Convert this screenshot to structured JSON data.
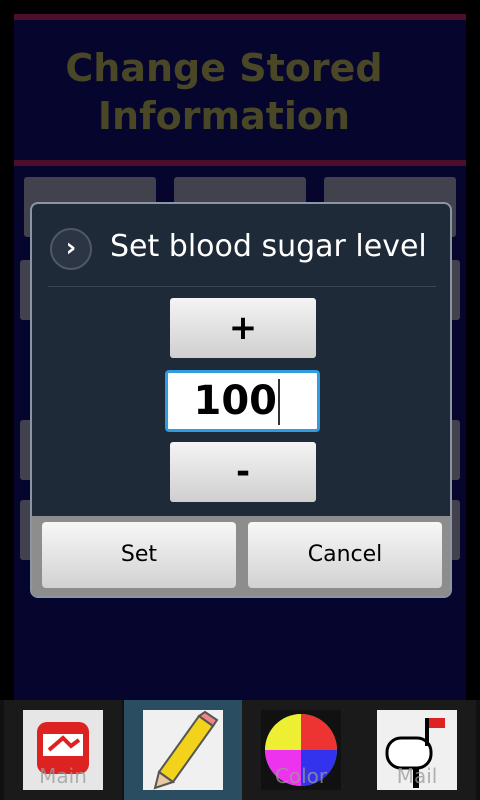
{
  "screen": {
    "title": "Change Stored Information"
  },
  "dialog": {
    "title": "Set blood sugar level",
    "increment_label": "+",
    "decrement_label": "-",
    "value": "100",
    "set_label": "Set",
    "cancel_label": "Cancel"
  },
  "tabs": [
    {
      "label": "Main",
      "icon": "main-icon"
    },
    {
      "label": "",
      "icon": "pencil-icon",
      "selected": true
    },
    {
      "label": "Color",
      "icon": "color-wheel-icon"
    },
    {
      "label": "Mail",
      "icon": "mailbox-icon"
    }
  ],
  "colors": {
    "bar": "#8b1a4e",
    "app_bg": "#0a0a55",
    "title": "#858246",
    "focus": "#2f9be0"
  }
}
